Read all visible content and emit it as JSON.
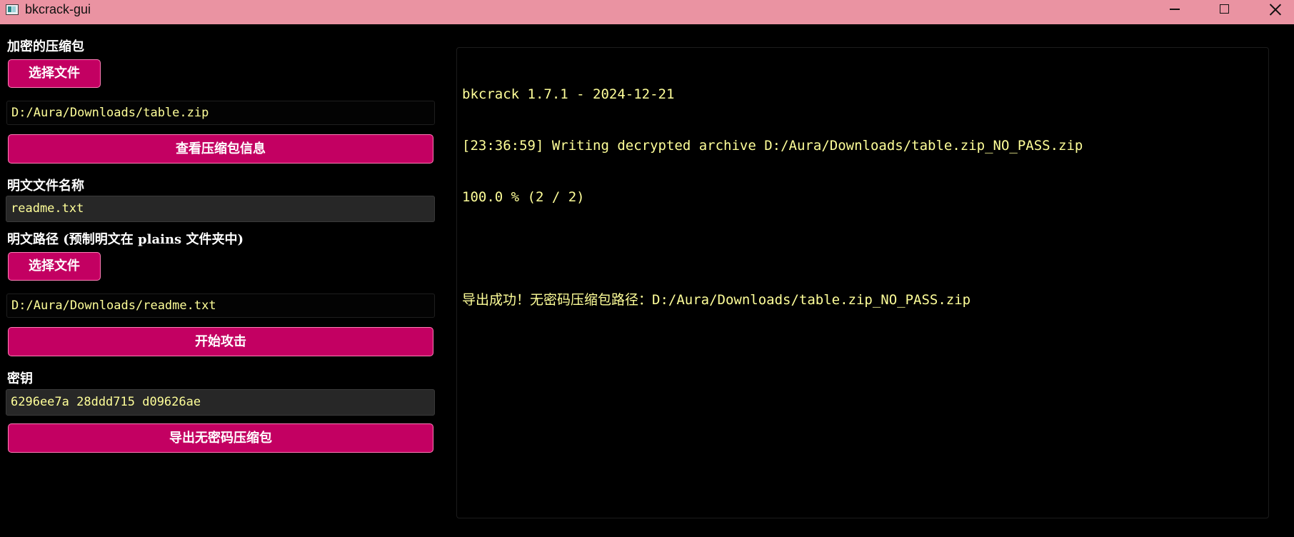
{
  "window": {
    "title": "bkcrack-gui",
    "titlebar_color": "#ea93a2",
    "accent_color": "#c30062",
    "text_color": "#ffff99"
  },
  "left_panel": {
    "encrypted_zip": {
      "label": "加密的压缩包",
      "choose_button": "选择文件",
      "path": "D:/Aura/Downloads/table.zip",
      "info_button": "查看压缩包信息"
    },
    "plain_name": {
      "label": "明文文件名称",
      "value": "readme.txt"
    },
    "plain_path": {
      "label": "明文路径 (预制明文在 plains 文件夹中)",
      "choose_button": "选择文件",
      "path": "D:/Aura/Downloads/readme.txt",
      "attack_button": "开始攻击"
    },
    "key": {
      "label": "密钥",
      "value": "6296ee7a 28ddd715 d09626ae",
      "export_button": "导出无密码压缩包"
    }
  },
  "log": {
    "lines": [
      "bkcrack 1.7.1 - 2024-12-21",
      "[23:36:59] Writing decrypted archive D:/Aura/Downloads/table.zip_NO_PASS.zip",
      "100.0 % (2 / 2)",
      "",
      "导出成功！无密码压缩包路径：D:/Aura/Downloads/table.zip_NO_PASS.zip"
    ]
  }
}
